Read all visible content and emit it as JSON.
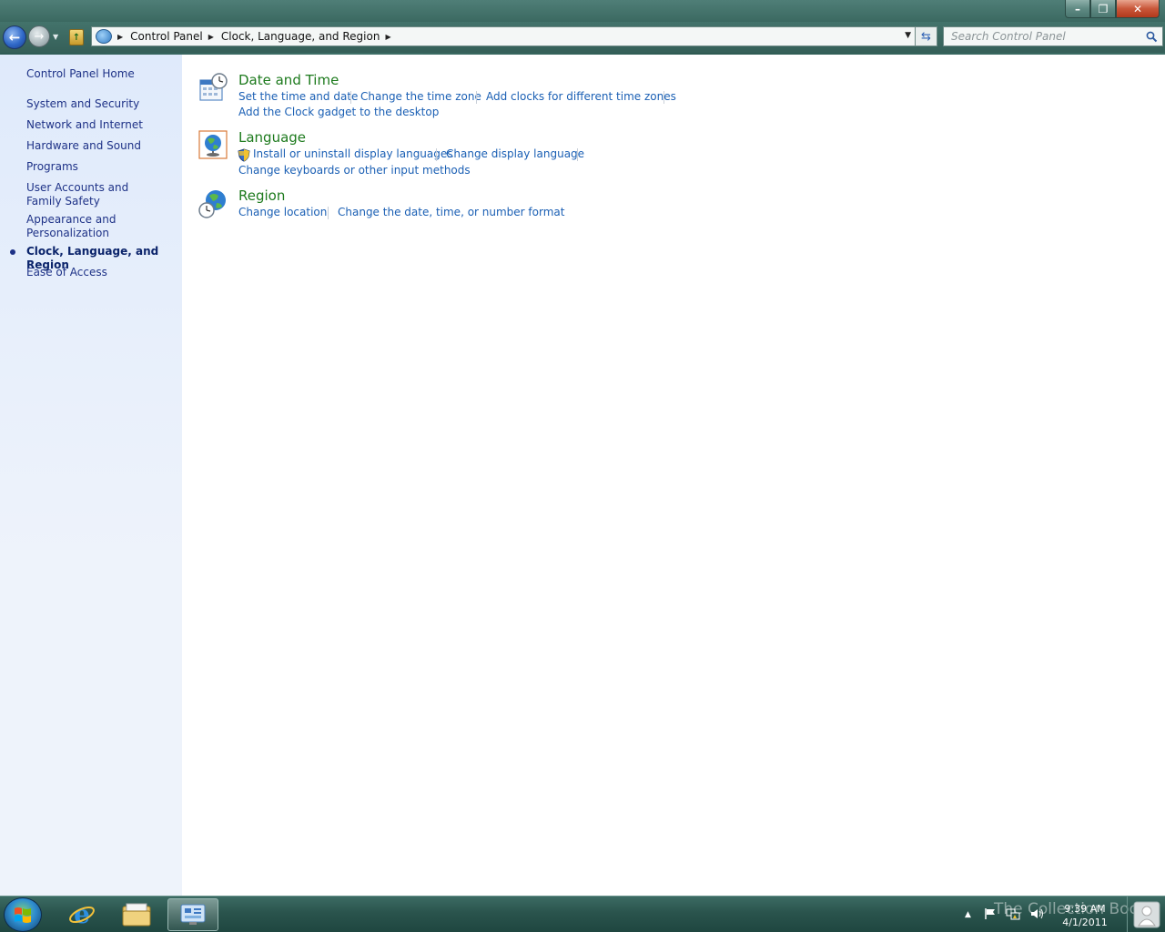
{
  "window": {
    "controls": {
      "minimize": "–",
      "maximize": "❐",
      "close": "✕"
    }
  },
  "nav": {
    "back_glyph": "←",
    "forward_glyph": "→",
    "breadcrumb": [
      "Control Panel",
      "Clock, Language, and Region"
    ],
    "search_placeholder": "Search Control Panel"
  },
  "sidebar": {
    "home": "Control Panel Home",
    "items": [
      "System and Security",
      "Network and Internet",
      "Hardware and Sound",
      "Programs",
      "User Accounts and Family Safety",
      "Appearance and Personalization",
      "Clock, Language, and Region",
      "Ease of Access"
    ],
    "current": "Clock, Language, and Region"
  },
  "categories": [
    {
      "title": "Date and Time",
      "icon": "calendar-clock-icon",
      "tasks": [
        "Set the time and date",
        "Change the time zone",
        "Add clocks for different time zones",
        "Add the Clock gadget to the desktop"
      ]
    },
    {
      "title": "Language",
      "icon": "globe-language-icon",
      "tasks": [
        "Install or uninstall display languages",
        "Change display language",
        "Change keyboards or other input methods"
      ]
    },
    {
      "title": "Region",
      "icon": "globe-clock-icon",
      "tasks": [
        "Change location",
        "Change the date, time, or number format"
      ]
    }
  ],
  "taskbar": {
    "pinned": [
      "internet-explorer-icon",
      "windows-explorer-icon",
      "control-panel-icon"
    ],
    "clock_time": "9:39 AM",
    "clock_date": "4/1/2011",
    "watermark": "The Collection Book"
  },
  "colors": {
    "link": "#1a5fb4",
    "category_title": "#1d7a1d",
    "sidebar_link": "#1e3287",
    "sidebar_bg": "#dfeafb",
    "glass": "#3f7068"
  }
}
